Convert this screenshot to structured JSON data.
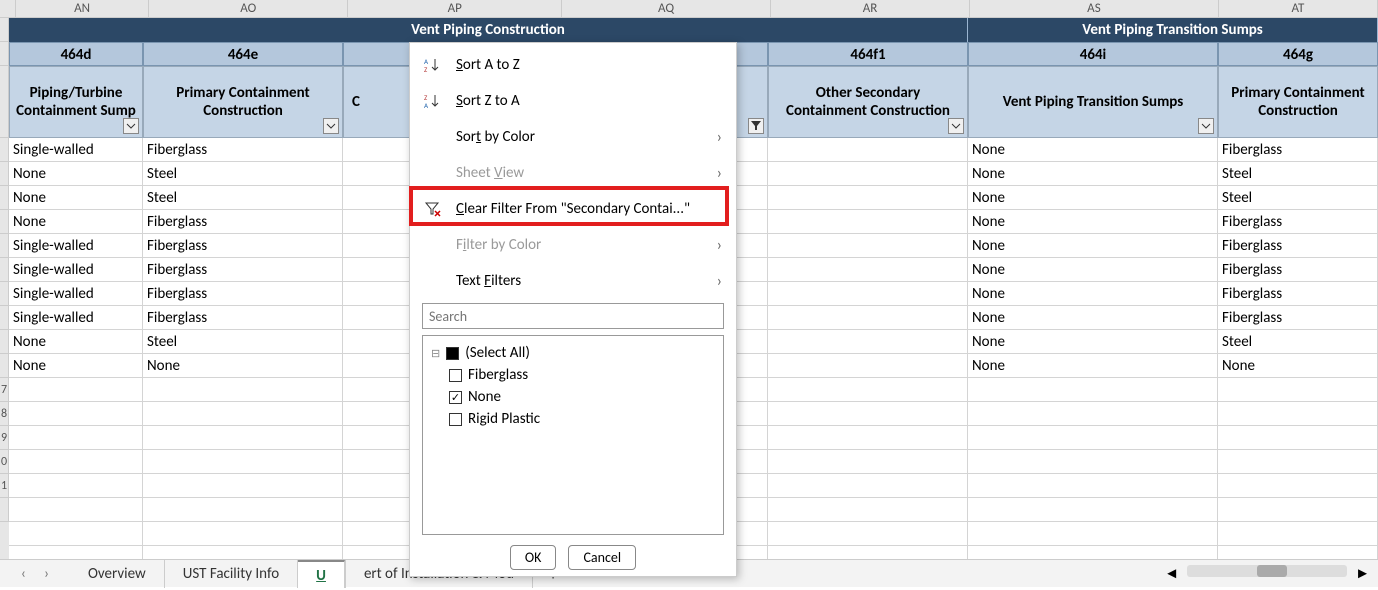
{
  "columns": [
    "AN",
    "AO",
    "AP",
    "AQ",
    "AR",
    "AS",
    "AT"
  ],
  "rowLabels": [
    "",
    "",
    "",
    "",
    "",
    "",
    "",
    "",
    "",
    "",
    "",
    "",
    "7",
    "8",
    "9",
    "0",
    "1",
    "",
    "",
    "",
    ""
  ],
  "section": {
    "ventConstruction": "Vent Piping Construction",
    "ventTransition": "Vent Piping Transition Sumps"
  },
  "codes": {
    "AN": "464d",
    "AO": "464e",
    "AR": "464f1",
    "AS": "464i",
    "AT": "464g"
  },
  "headers": {
    "AN": "Piping/Turbine Containment Sump",
    "AO": "Primary Containment Construction",
    "AP": "C",
    "AR": "Other Secondary Containment Construction",
    "AS": "Vent Piping Transition Sumps",
    "AT": "Primary Containment Construction"
  },
  "rows": [
    {
      "AN": "Single-walled",
      "AO": "Fiberglass",
      "AR": "",
      "AS": "None",
      "AT": "Fiberglass"
    },
    {
      "AN": "None",
      "AO": "Steel",
      "AR": "",
      "AS": "None",
      "AT": "Steel"
    },
    {
      "AN": "None",
      "AO": "Steel",
      "AR": "",
      "AS": "None",
      "AT": "Steel"
    },
    {
      "AN": "None",
      "AO": "Fiberglass",
      "AR": "",
      "AS": "None",
      "AT": "Fiberglass"
    },
    {
      "AN": "Single-walled",
      "AO": "Fiberglass",
      "AR": "",
      "AS": "None",
      "AT": "Fiberglass"
    },
    {
      "AN": "Single-walled",
      "AO": "Fiberglass",
      "AR": "",
      "AS": "None",
      "AT": "Fiberglass"
    },
    {
      "AN": "Single-walled",
      "AO": "Fiberglass",
      "AR": "",
      "AS": "None",
      "AT": "Fiberglass"
    },
    {
      "AN": "Single-walled",
      "AO": "Fiberglass",
      "AR": "",
      "AS": "None",
      "AT": "Fiberglass"
    },
    {
      "AN": "None",
      "AO": "Steel",
      "AR": "",
      "AS": "None",
      "AT": "Steel"
    },
    {
      "AN": "None",
      "AO": "None",
      "AR": "",
      "AS": "None",
      "AT": "None"
    }
  ],
  "menu": {
    "sortAZ": "Sort A to Z",
    "sortZA": "Sort Z to A",
    "sortByColor": "Sort by Color",
    "sheetView": "Sheet View",
    "clearFilter": "Clear Filter From \"Secondary  Contai...\"",
    "filterByColor": "Filter by Color",
    "textFilters": "Text Filters",
    "searchPlaceholder": "Search",
    "selectAll": "(Select All)",
    "optFiberglass": "Fiberglass",
    "optNone": "None",
    "optRigid": "Rigid Plastic",
    "ok": "OK",
    "cancel": "Cancel"
  },
  "tabs": {
    "overview": "Overview",
    "ust": "UST Facility Info",
    "active": "U",
    "cert": "ert of Installation & Mod"
  }
}
